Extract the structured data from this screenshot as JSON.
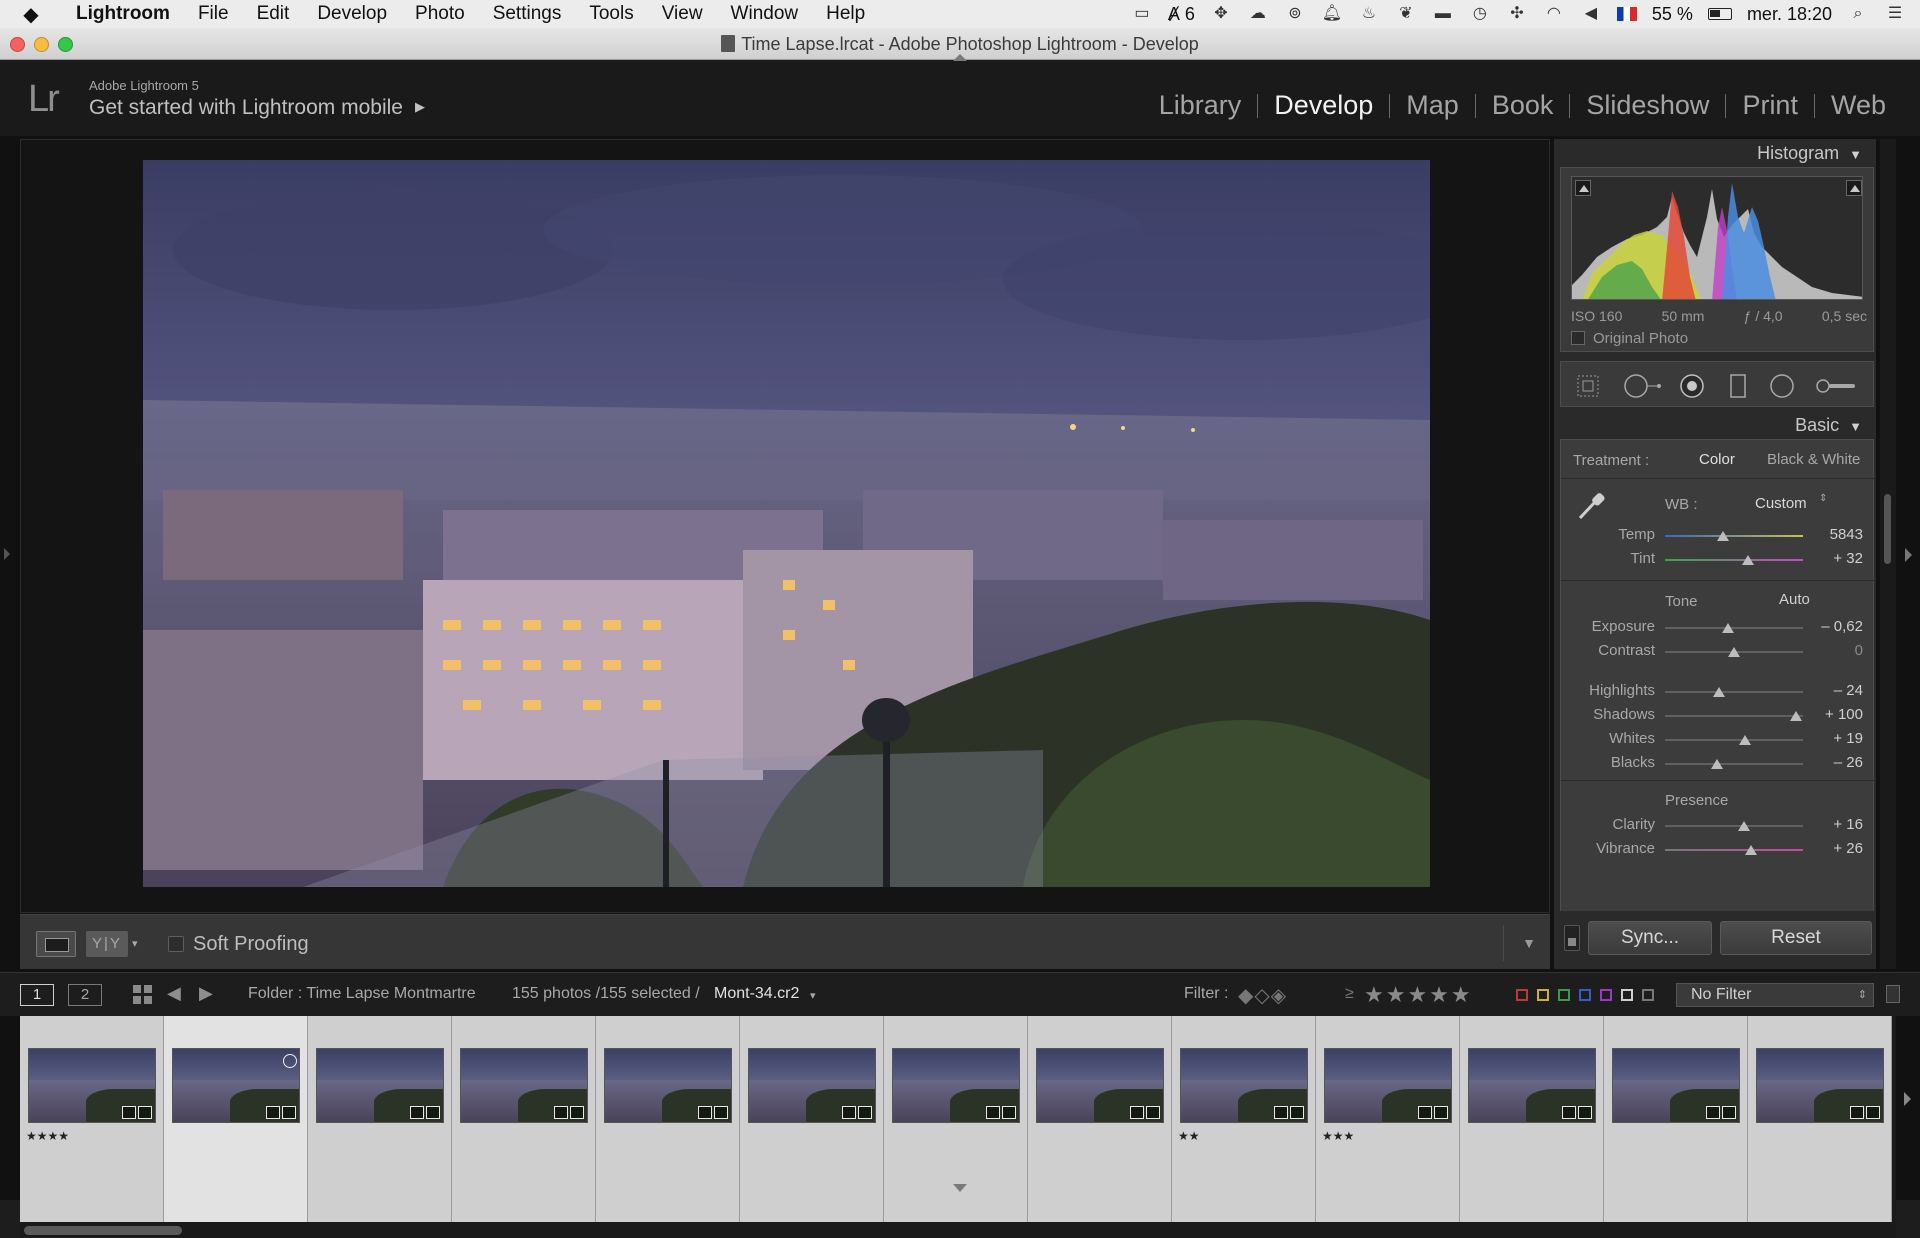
{
  "menubar": {
    "app_name": "Lightroom",
    "items": [
      "File",
      "Edit",
      "Develop",
      "Photo",
      "Settings",
      "Tools",
      "View",
      "Window",
      "Help"
    ],
    "adobe_badge": "6",
    "battery": "55 %",
    "clock": "mer. 18:20"
  },
  "window": {
    "title": "Time Lapse.lrcat - Adobe Photoshop Lightroom - Develop"
  },
  "identity": {
    "logo": "Lr",
    "product": "Adobe Lightroom 5",
    "tagline": "Get started with Lightroom mobile",
    "arrow": "▶"
  },
  "modules": {
    "items": [
      "Library",
      "Develop",
      "Map",
      "Book",
      "Slideshow",
      "Print",
      "Web"
    ],
    "active": "Develop"
  },
  "histogram": {
    "title": "Histogram",
    "iso": "ISO 160",
    "focal": "50 mm",
    "aperture": "ƒ / 4,0",
    "shutter": "0,5 sec",
    "original_photo_label": "Original Photo"
  },
  "basic": {
    "title": "Basic",
    "treatment_label": "Treatment :",
    "treatment_color": "Color",
    "treatment_bw": "Black & White",
    "wb_label": "WB :",
    "wb_value": "Custom",
    "temp_label": "Temp",
    "temp_value": "5843",
    "tint_label": "Tint",
    "tint_value": "+ 32",
    "tone_label": "Tone",
    "auto_label": "Auto",
    "exposure_label": "Exposure",
    "exposure_value": "– 0,62",
    "contrast_label": "Contrast",
    "contrast_value": "0",
    "highlights_label": "Highlights",
    "highlights_value": "– 24",
    "shadows_label": "Shadows",
    "shadows_value": "+ 100",
    "whites_label": "Whites",
    "whites_value": "+ 19",
    "blacks_label": "Blacks",
    "blacks_value": "– 26",
    "presence_label": "Presence",
    "clarity_label": "Clarity",
    "clarity_value": "+ 16",
    "vibrance_label": "Vibrance",
    "vibrance_value": "+ 26"
  },
  "panel_buttons": {
    "sync": "Sync...",
    "reset": "Reset"
  },
  "toolbar": {
    "yy_label": "Y|Y",
    "soft_proofing": "Soft Proofing"
  },
  "filmstrip_bar": {
    "view1": "1",
    "view2": "2",
    "folder": "Folder : Time Lapse Montmartre",
    "count": "155 photos /155 selected /",
    "filename": "Mont-34.cr2",
    "filter_label": "Filter :",
    "rating_op": "≥",
    "stars": "★★★★★",
    "filter_preset": "No Filter"
  },
  "filmstrip": {
    "cells": [
      {
        "stars": "★★★★",
        "selected": false
      },
      {
        "stars": "",
        "selected": true
      },
      {
        "stars": "",
        "selected": false
      },
      {
        "stars": "",
        "selected": false
      },
      {
        "stars": "",
        "selected": false
      },
      {
        "stars": "",
        "selected": false
      },
      {
        "stars": "",
        "selected": false
      },
      {
        "stars": "",
        "selected": false
      },
      {
        "stars": "★★",
        "selected": false
      },
      {
        "stars": "★★★",
        "selected": false
      },
      {
        "stars": "",
        "selected": false
      },
      {
        "stars": "",
        "selected": false
      },
      {
        "stars": "",
        "selected": false
      }
    ]
  },
  "sliders": {
    "temp": 0.42,
    "tint": 0.6,
    "exposure": 0.46,
    "contrast": 0.5,
    "highlights": 0.39,
    "shadows": 0.95,
    "whites": 0.58,
    "blacks": 0.38,
    "clarity": 0.57,
    "vibrance": 0.62
  },
  "colors": {
    "accent": "#f2f2f2",
    "panel_bg": "#2a2a2a",
    "filmstrip_cell": "#cfcfcf"
  },
  "icons": [
    "apple-icon",
    "camera-icon",
    "adobe-icon",
    "dropbox-icon",
    "wifi-icon",
    "volume-icon",
    "flag-icon",
    "battery-icon",
    "search-icon",
    "list-icon",
    "eyedropper-icon",
    "grid-icon",
    "crop-icon",
    "spot-icon",
    "redeye-icon",
    "gradient-icon",
    "radial-icon",
    "brush-icon"
  ]
}
